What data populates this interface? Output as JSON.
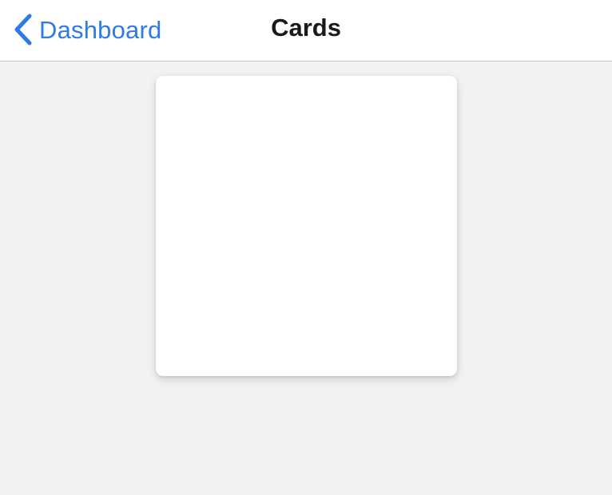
{
  "navbar": {
    "back_label": "Dashboard",
    "back_icon": "chevron-left-icon",
    "title": "Cards"
  },
  "colors": {
    "accent": "#2f7ae5",
    "background": "#f2f2f2",
    "card": "#ffffff",
    "title_text": "#1a1a1a"
  }
}
